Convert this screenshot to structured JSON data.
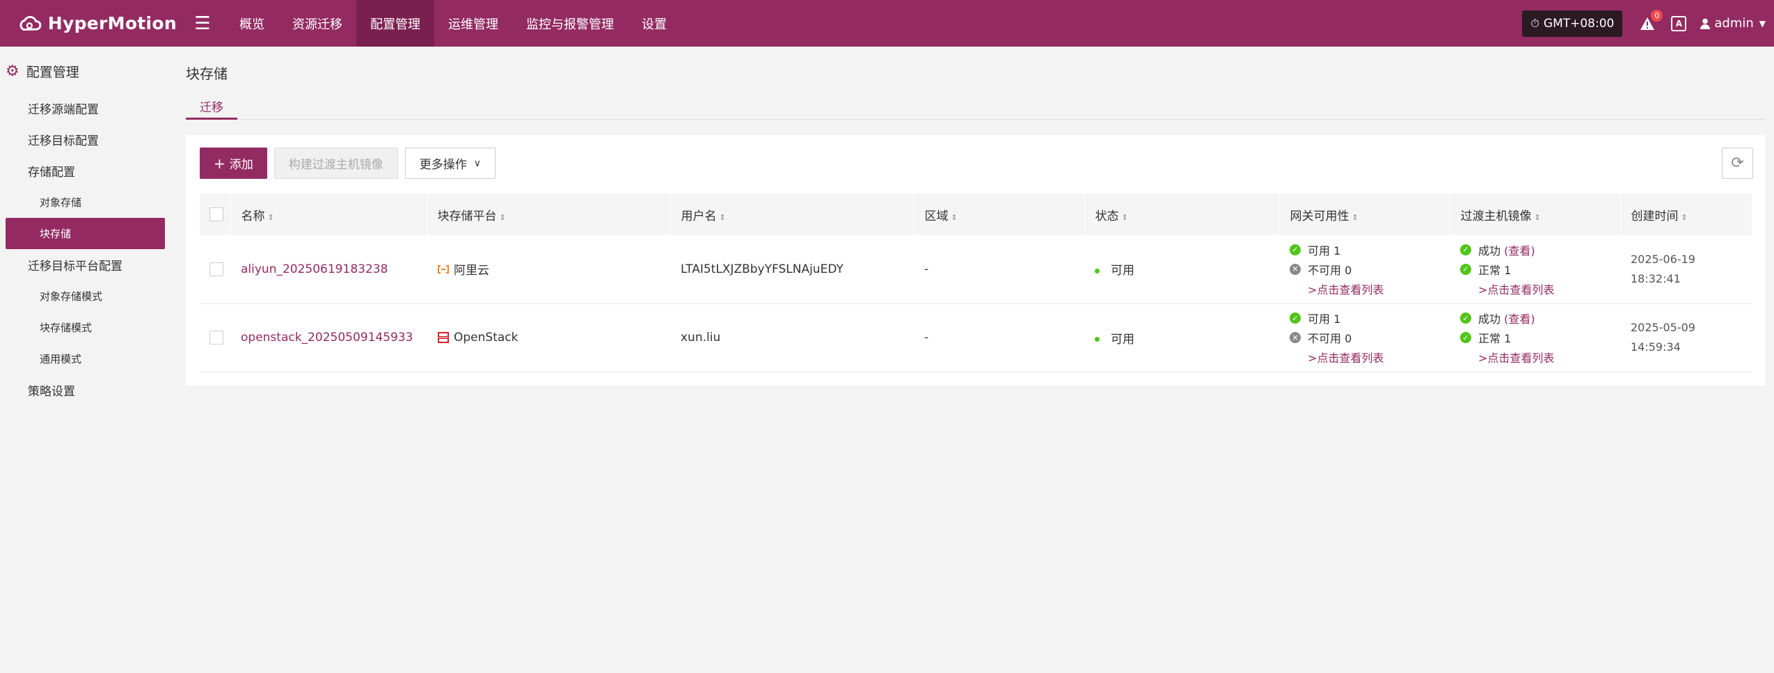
{
  "brand": {
    "name": "HyperMotion"
  },
  "nav": [
    "概览",
    "资源迁移",
    "配置管理",
    "运维管理",
    "监控与报警管理",
    "设置"
  ],
  "topbar": {
    "timezone": "GMT+08:00",
    "alert_count": "0",
    "lang": "A",
    "user": "admin"
  },
  "sidebar": {
    "title": "配置管理",
    "items": {
      "source": "迁移源端配置",
      "target": "迁移目标配置",
      "storage": "存储配置",
      "object_storage": "对象存储",
      "block_storage": "块存储",
      "target_platform": "迁移目标平台配置",
      "object_mode": "对象存储模式",
      "block_mode": "块存储模式",
      "general_mode": "通用模式",
      "policy": "策略设置"
    }
  },
  "page": {
    "title": "块存储",
    "tab": "迁移"
  },
  "toolbar": {
    "add": "添加",
    "build_image": "构建过渡主机镜像",
    "more": "更多操作"
  },
  "table": {
    "headers": [
      "名称",
      "块存储平台",
      "用户名",
      "区域",
      "状态",
      "网关可用性",
      "过渡主机镜像",
      "创建时间"
    ],
    "rows": [
      {
        "name": "aliyun_20250619183238",
        "platform": "阿里云",
        "username": "LTAI5tLXJZBbyYFSLNAjuEDY",
        "region": "-",
        "status": "可用",
        "gw_ok": "可用 1",
        "gw_no": "不可用 0",
        "gw_link": ">点击查看列表",
        "img_success": "成功",
        "img_view": "(查看)",
        "img_normal": "正常 1",
        "img_link": ">点击查看列表",
        "date": "2025-06-19",
        "time": "18:32:41"
      },
      {
        "name": "openstack_20250509145933",
        "platform": "OpenStack",
        "username": "xun.liu",
        "region": "-",
        "status": "可用",
        "gw_ok": "可用 1",
        "gw_no": "不可用 0",
        "gw_link": ">点击查看列表",
        "img_success": "成功",
        "img_view": "(查看)",
        "img_normal": "正常 1",
        "img_link": ">点击查看列表",
        "date": "2025-05-09",
        "time": "14:59:34"
      }
    ]
  },
  "colors": {
    "brand": "#932b62",
    "success": "#52c41a"
  }
}
